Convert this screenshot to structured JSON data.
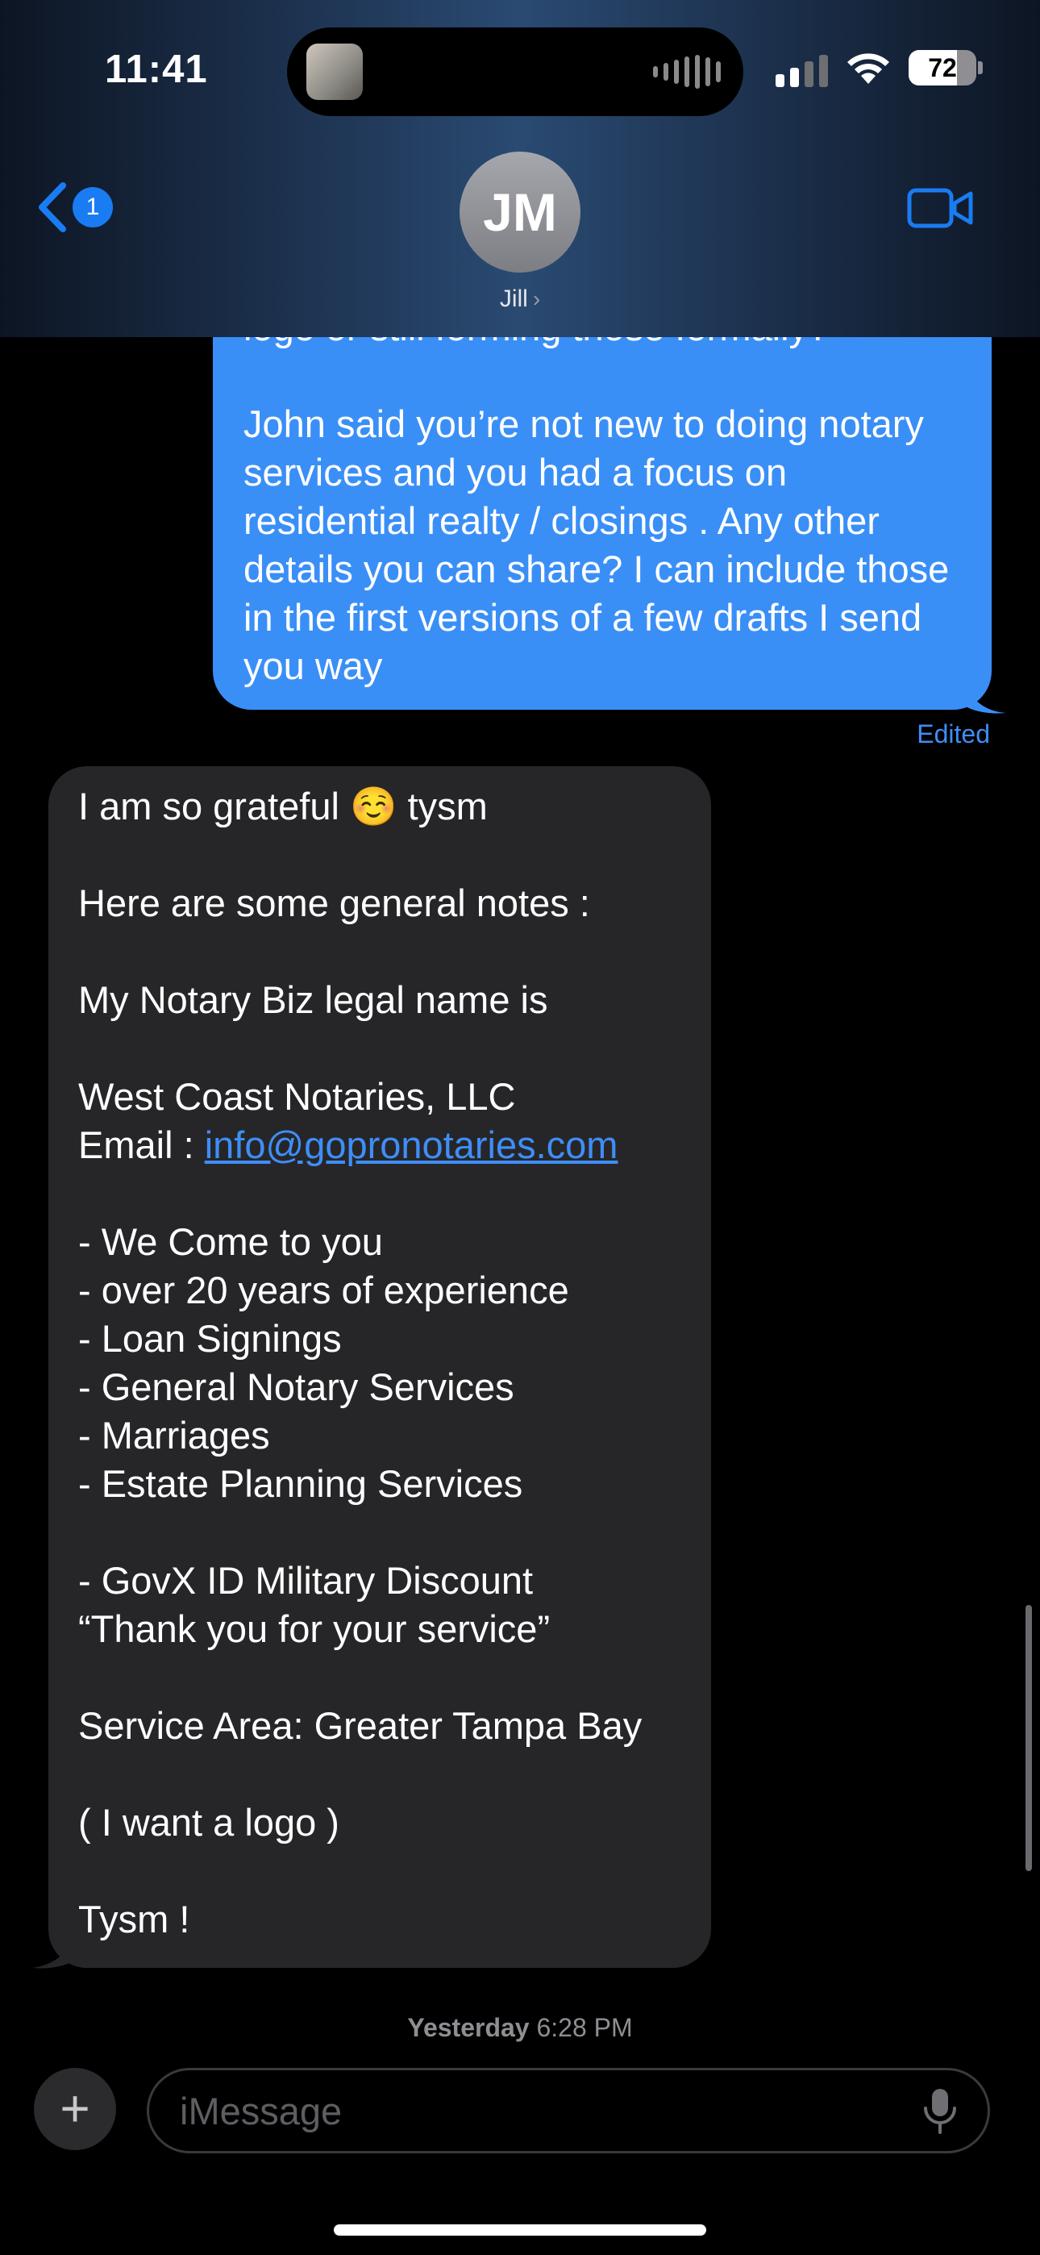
{
  "status_bar": {
    "time": "11:41",
    "battery": "72",
    "battery_level": 0.72,
    "signal_bars_active": 2,
    "signal_bars_total": 4
  },
  "header": {
    "back_badge": "1",
    "avatar_initials": "JM",
    "contact_name": "Jill",
    "chevron": "›"
  },
  "messages": {
    "sent": {
      "text": "logo or still forming those formally?\n\nJohn said you’re not new to doing notary services and you had a focus on residential realty / closings . Any other details you can share? I can include those in the first versions of a few drafts I send you way",
      "status": "Edited",
      "color": "#3a8ff7"
    },
    "received": {
      "intro": "I am so grateful ☺️ tysm\n\nHere are some general notes :\n\nMy Notary Biz legal name is\n\nWest Coast Notaries, LLC",
      "email_label": "Email : ",
      "email": "info@gopronotaries.com",
      "body": "\n- We Come to you\n- over 20 years of experience\n- Loan Signings\n- General Notary Services\n- Marriages\n- Estate Planning Services\n\n- GovX ID Military Discount\n“Thank you for your service”\n\nService Area: Greater Tampa Bay\n\n( I want a logo )\n\nTysm !",
      "color": "#262629"
    },
    "timestamp_day": "Yesterday",
    "timestamp_time": " 6:28 PM"
  },
  "composer": {
    "plus": "+",
    "placeholder": "iMessage"
  },
  "icons": {
    "back": "chevron-left-icon",
    "video": "video-camera-icon",
    "mic": "microphone-icon",
    "add": "plus-icon",
    "wifi": "wifi-icon",
    "cellular": "cellular-signal-icon",
    "battery": "battery-icon"
  },
  "accent": "#1a7cf2"
}
